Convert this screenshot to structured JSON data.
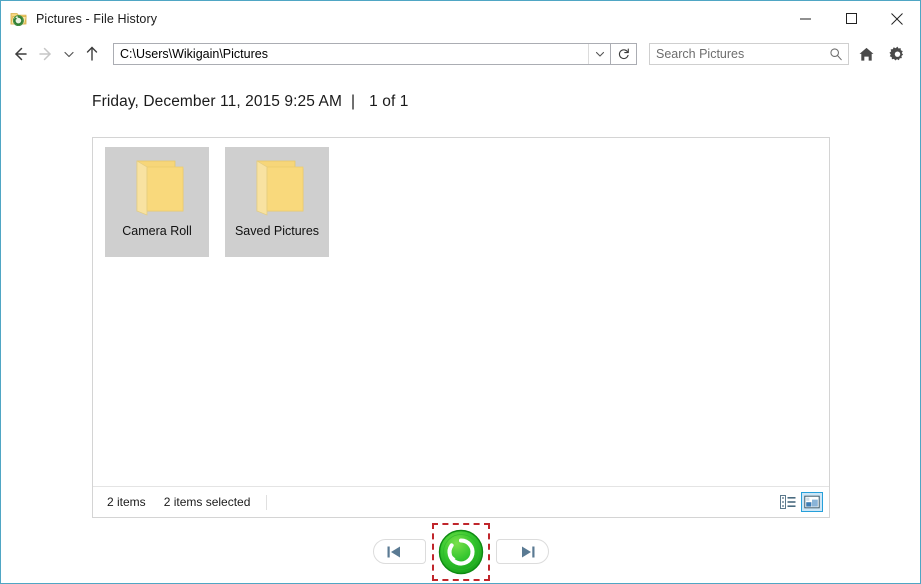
{
  "window": {
    "title": "Pictures - File History",
    "icon": "file-history-folder-icon",
    "border_color": "#4fa6c4",
    "controls": {
      "minimize_label": "Minimize",
      "maximize_label": "Maximize",
      "close_label": "Close"
    }
  },
  "navbar": {
    "back_label": "Back",
    "forward_label": "Forward",
    "recent_label": "Recent locations",
    "up_label": "Up one level",
    "address": {
      "value": "C:\\Users\\Wikigain\\Pictures",
      "dropdown_label": "Previous locations"
    },
    "refresh_label": "Refresh",
    "search": {
      "placeholder": "Search Pictures",
      "value": ""
    },
    "home_label": "Home",
    "settings_label": "Settings"
  },
  "header": {
    "date": "Friday, December 11, 2015 9:25 AM",
    "separator": "|",
    "position": "1 of 1"
  },
  "content": {
    "items": [
      {
        "name": "Camera Roll",
        "icon": "folder-open-icon",
        "selected": true
      },
      {
        "name": "Saved Pictures",
        "icon": "folder-open-icon",
        "selected": true
      }
    ]
  },
  "statusbar": {
    "item_count": "2 items",
    "selection": "2 items selected",
    "views": [
      {
        "name": "details-view",
        "label": "Details view",
        "active": false
      },
      {
        "name": "large-icons-view",
        "label": "Large icons view",
        "active": true
      }
    ]
  },
  "bottom": {
    "previous_label": "Previous version",
    "restore_label": "Restore to original location",
    "next_label": "Next version",
    "restore_color": "#32c832",
    "highlight_color": "#c0262c"
  }
}
